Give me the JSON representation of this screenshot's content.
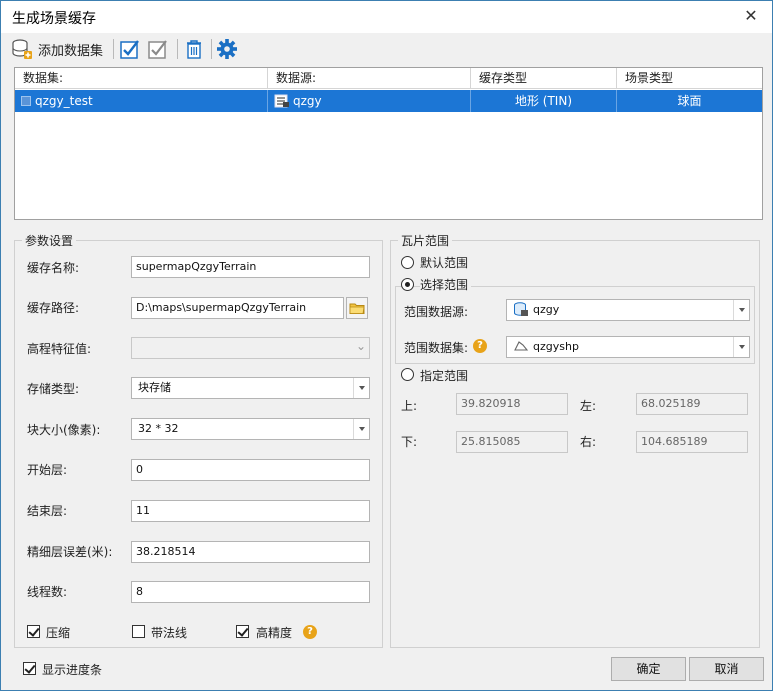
{
  "window": {
    "title": "生成场景缓存"
  },
  "toolbar": {
    "add_dataset_label": "添加数据集"
  },
  "table": {
    "columns": [
      "数据集:",
      "数据源:",
      "缓存类型",
      "场景类型"
    ],
    "rows": [
      {
        "dataset": "qzgy_test",
        "datasource": "qzgy",
        "cache_type": "地形 (TIN)",
        "scene_type": "球面"
      }
    ]
  },
  "params": {
    "group_title": "参数设置",
    "cache_name_label": "缓存名称:",
    "cache_name_value": "supermapQzgyTerrain",
    "cache_path_label": "缓存路径:",
    "cache_path_value": "D:\\maps\\supermapQzgyTerrain",
    "elevation_label": "高程特征值:",
    "storage_type_label": "存储类型:",
    "storage_type_value": "块存储",
    "block_size_label": "块大小(像素):",
    "block_size_value": "32 * 32",
    "start_level_label": "开始层:",
    "start_level_value": "0",
    "end_level_label": "结束层:",
    "end_level_value": "11",
    "fine_error_label": "精细层误差(米):",
    "fine_error_value": "38.218514",
    "threads_label": "线程数:",
    "threads_value": "8",
    "compress_label": "压缩",
    "compress_checked": true,
    "normals_label": "带法线",
    "normals_checked": false,
    "high_precision_label": "高精度",
    "high_precision_checked": true
  },
  "tiles": {
    "group_title": "瓦片范围",
    "default_range_label": "默认范围",
    "select_range_label": "选择范围",
    "range_datasource_label": "范围数据源:",
    "range_datasource_value": "qzgy",
    "range_dataset_label": "范围数据集:",
    "range_dataset_value": "qzgyshp",
    "specify_range_label": "指定范围",
    "top_label": "上:",
    "top_value": "39.820918",
    "left_label": "左:",
    "left_value": "68.025189",
    "bottom_label": "下:",
    "bottom_value": "25.815085",
    "right_label": "右:",
    "right_value": "104.685189"
  },
  "footer": {
    "show_progress_label": "显示进度条",
    "show_progress_checked": true,
    "ok_label": "确定",
    "cancel_label": "取消"
  },
  "colors": {
    "selection": "#1c76d5",
    "accent": "#1a6fc4",
    "help": "#e8a319"
  }
}
